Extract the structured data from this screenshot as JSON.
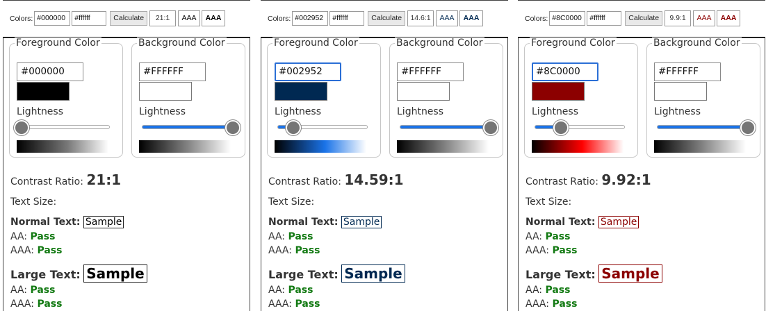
{
  "colors": {
    "pass": "#137a13",
    "accent": "#1a73e8"
  },
  "panels": [
    {
      "toolbar": {
        "label": "Colors:",
        "fg": "#000000",
        "bg": "#ffffff",
        "calc": "Calculate",
        "ratio": "21:1",
        "aa": "AAA",
        "aaa": "AAA",
        "badge_color": "#000000"
      },
      "fg": {
        "legend": "Foreground Color",
        "hex": "#000000",
        "swatch": "#000000",
        "lightness_label": "Lightness",
        "lightness": 0.0,
        "gradient_mid": "#777777"
      },
      "bg": {
        "legend": "Background Color",
        "hex": "#FFFFFF",
        "swatch": "#FFFFFF",
        "lightness_label": "Lightness",
        "lightness": 1.0
      },
      "result": {
        "ratio_label": "Contrast Ratio:",
        "ratio": "21:1",
        "text_size": "Text Size:",
        "normal_label": "Normal Text:",
        "normal_sample": "Sample",
        "large_label": "Large Text:",
        "large_sample": "Sample",
        "aa_label": "AA:",
        "aaa_label": "AAA:",
        "pass": "Pass",
        "sample_color": "#000000"
      }
    },
    {
      "toolbar": {
        "label": "Colors:",
        "fg": "#002952",
        "bg": "#ffffff",
        "calc": "Calculate",
        "ratio": "14.6:1",
        "aa": "AAA",
        "aaa": "AAA",
        "badge_color": "#002952"
      },
      "fg": {
        "legend": "Foreground Color",
        "hex": "#002952",
        "swatch": "#002952",
        "lightness_label": "Lightness",
        "lightness": 0.16,
        "gradient_mid": "#1a73e8"
      },
      "bg": {
        "legend": "Background Color",
        "hex": "#FFFFFF",
        "swatch": "#FFFFFF",
        "lightness_label": "Lightness",
        "lightness": 1.0
      },
      "result": {
        "ratio_label": "Contrast Ratio:",
        "ratio": "14.59:1",
        "text_size": "Text Size:",
        "normal_label": "Normal Text:",
        "normal_sample": "Sample",
        "large_label": "Large Text:",
        "large_sample": "Sample",
        "aa_label": "AA:",
        "aaa_label": "AAA:",
        "pass": "Pass",
        "sample_color": "#002952"
      }
    },
    {
      "toolbar": {
        "label": "Colors:",
        "fg": "#8C0000",
        "bg": "#ffffff",
        "calc": "Calculate",
        "ratio": "9.9:1",
        "aa": "AAA",
        "aaa": "AAA",
        "badge_color": "#8C0000"
      },
      "fg": {
        "legend": "Foreground Color",
        "hex": "#8C0000",
        "swatch": "#8C0000",
        "lightness_label": "Lightness",
        "lightness": 0.27,
        "gradient_mid": "#ff0000"
      },
      "bg": {
        "legend": "Background Color",
        "hex": "#FFFFFF",
        "swatch": "#FFFFFF",
        "lightness_label": "Lightness",
        "lightness": 1.0
      },
      "result": {
        "ratio_label": "Contrast Ratio:",
        "ratio": "9.92:1",
        "text_size": "Text Size:",
        "normal_label": "Normal Text:",
        "normal_sample": "Sample",
        "large_label": "Large Text:",
        "large_sample": "Sample",
        "aa_label": "AA:",
        "aaa_label": "AAA:",
        "pass": "Pass",
        "sample_color": "#8C0000"
      }
    }
  ]
}
